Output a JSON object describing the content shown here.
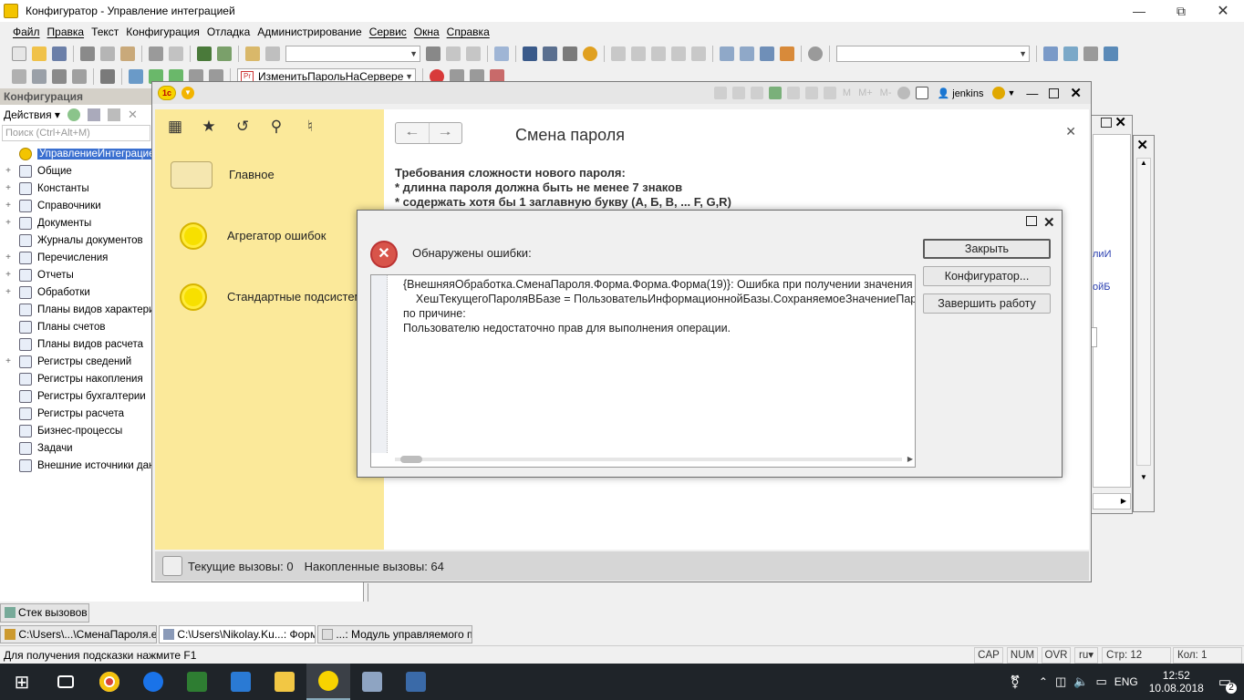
{
  "window": {
    "title": "Конфигуратор - Управление интеграцией"
  },
  "menu": [
    "Файл",
    "Правка",
    "Текст",
    "Конфигурация",
    "Отладка",
    "Администрирование",
    "Сервис",
    "Окна",
    "Справка"
  ],
  "toolbar": {
    "method_combo": "ИзменитьПарольНаСервере"
  },
  "config_panel": {
    "header": "Конфигурация",
    "actions_label": "Действия",
    "search_placeholder": "Поиск (Ctrl+Alt+M)",
    "tree": [
      {
        "label": "УправлениеИнтеграцией",
        "selected": true,
        "expander": ""
      },
      {
        "label": "Общие",
        "expander": "+"
      },
      {
        "label": "Константы",
        "expander": "+"
      },
      {
        "label": "Справочники",
        "expander": "+"
      },
      {
        "label": "Документы",
        "expander": "+"
      },
      {
        "label": "Журналы документов",
        "expander": ""
      },
      {
        "label": "Перечисления",
        "expander": "+"
      },
      {
        "label": "Отчеты",
        "expander": "+"
      },
      {
        "label": "Обработки",
        "expander": "+"
      },
      {
        "label": "Планы видов характеристик",
        "expander": ""
      },
      {
        "label": "Планы счетов",
        "expander": ""
      },
      {
        "label": "Планы видов расчета",
        "expander": ""
      },
      {
        "label": "Регистры сведений",
        "expander": "+"
      },
      {
        "label": "Регистры накопления",
        "expander": ""
      },
      {
        "label": "Регистры бухгалтерии",
        "expander": ""
      },
      {
        "label": "Регистры расчета",
        "expander": ""
      },
      {
        "label": "Бизнес-процессы",
        "expander": ""
      },
      {
        "label": "Задачи",
        "expander": ""
      },
      {
        "label": "Внешние источники данных",
        "expander": ""
      }
    ]
  },
  "app_window": {
    "user": "jenkins",
    "nav_items": [
      {
        "label": "Главное"
      },
      {
        "label": "Агрегатор ошибок"
      },
      {
        "label": "Стандартные подсистемы"
      }
    ],
    "form_title": "Смена пароля",
    "requirements": [
      "Требования сложности нового пароля:",
      "* длинна пароля должна быть не менее 7 знаков",
      "* содержать хотя бы 1 заглавную букву (А, Б, В, ... F, G,R)"
    ],
    "status": {
      "current_calls": "Текущие вызовы: 0",
      "accumulated_calls": "Накопленные вызовы: 64"
    }
  },
  "error_dialog": {
    "message": "Обнаружены ошибки:",
    "details": [
      "{ВнешняяОбработка.СменаПароля.Форма.Форма.Форма(19)}: Ошибка при получении значения атрибута контекста (СохраняемоеЗначениеПароля)",
      "    ХешТекущегоПароляВБазе = ПользовательИнформационнойБазы.СохраняемоеЗначениеПароля;",
      "по причине:",
      "Пользователю недостаточно прав для выполнения операции."
    ],
    "buttons": {
      "close": "Закрыть",
      "configurator": "Конфигуратор...",
      "exit": "Завершить работу"
    }
  },
  "bg_fragments": {
    "a": "лиИ",
    "b": "ойБ"
  },
  "call_stack_tab": "Стек вызовов",
  "window_tabs": [
    {
      "label": "C:\\Users\\...\\СменаПароля.epf",
      "active": false
    },
    {
      "label": "C:\\Users\\Nikolay.Ku...: Форма",
      "active": true
    },
    {
      "label": "...: Модуль управляемого п...",
      "active": false
    }
  ],
  "statusbar": {
    "hint": "Для получения подсказки нажмите F1",
    "cap": "CAP",
    "num": "NUM",
    "ovr": "OVR",
    "lang": "ru",
    "line": "Стр: 12",
    "col": "Кол: 1"
  },
  "taskbar": {
    "lang": "ENG",
    "time": "12:52",
    "date": "10.08.2018",
    "notifications": "2"
  },
  "colors": {
    "sidebar": "#fbe99a",
    "selection": "#3a6fd0",
    "taskbar": "#1f2429"
  }
}
